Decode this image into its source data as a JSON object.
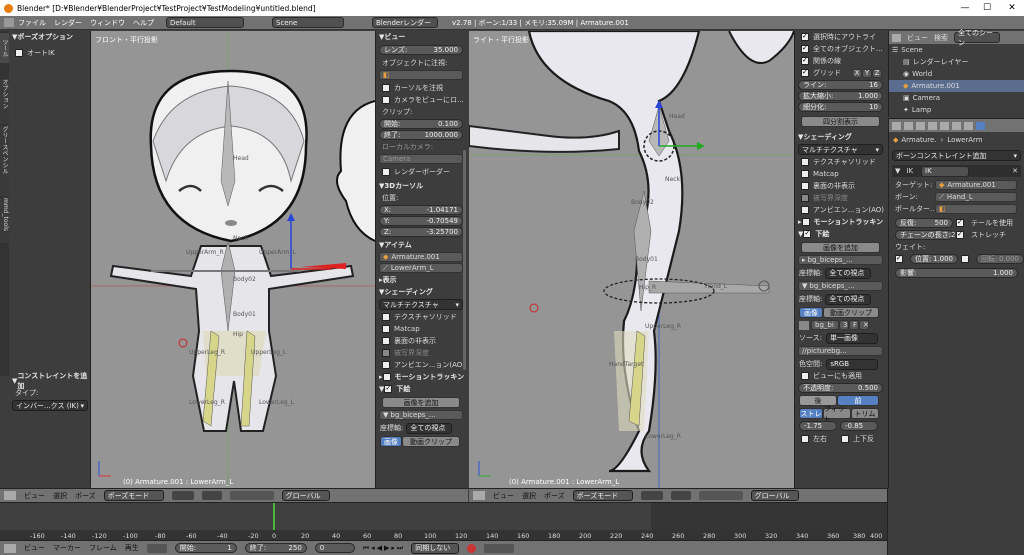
{
  "window": {
    "title": "Blender* [D:¥Blender¥BlenderProject¥TestProject¥TestModeling¥untitled.blend]",
    "min": "—",
    "max": "☐",
    "close": "✕"
  },
  "menubar": {
    "items": [
      "ファイル",
      "レンダー",
      "ウィンドウ",
      "ヘルプ"
    ],
    "layout": "Default",
    "scene": "Scene",
    "engine": "Blenderレンダー",
    "info": "v2.78 | ボーン:1/33 | メモリ:35.09M | Armature.001"
  },
  "left_tabs": [
    "ツール",
    "オプション",
    "グリースペンシル",
    "mmd_tools"
  ],
  "pose_options": {
    "header": "ポーズオプション",
    "auto_ik": "オートIK"
  },
  "constraint_add": {
    "header": "コンストレイントを追加",
    "type_label": "タイプ:",
    "type_value": "インバー...クス (IK)"
  },
  "viewport_left": {
    "title": "フロント・平行投影",
    "status": "(0) Armature.001 : LowerArm_L"
  },
  "viewport_right": {
    "title": "ライト・平行投影",
    "status": "(0) Armature.001 : LowerArm_L"
  },
  "bone_labels_left": [
    "Head",
    "Neck",
    "UpperArm_R",
    "UpperArm_L",
    "Body02",
    "Body01",
    "Hip",
    "UpperLeg_R",
    "UpperLeg_L",
    "LowerLeg_R",
    "LowerLeg_L"
  ],
  "bone_labels_right": [
    "Head",
    "Neck",
    "Body02",
    "Body01",
    "Hip_R",
    "UpperLeg_R",
    "LowerLeg_R",
    "HandTarget",
    "Hand_L"
  ],
  "nprops": {
    "view_header": "ビュー",
    "lens_label": "レンズ:",
    "lens_value": "35.000",
    "lock_obj_label": "オブジェクトに注視:",
    "lock_cursor": "カーソルを注視",
    "lock_camera": "カメラをビューにロ...",
    "clip_label": "クリップ:",
    "clip_start_label": "開始:",
    "clip_start": "0.100",
    "clip_end_label": "終了:",
    "clip_end": "1000.000",
    "local_camera": "ローカルカメラ:",
    "camera": "Camera",
    "render_border": "レンダーボーダー",
    "cursor_header": "3Dカーソル",
    "location": "位置:",
    "x_label": "X:",
    "x": "-1.04171",
    "y_label": "Y:",
    "y": "-0.70549",
    "z_label": "Z:",
    "z": "-3.25700",
    "item_header": "アイテム",
    "item_name": "Armature.001",
    "bone_name": "LowerArm_L",
    "display_header": "表示",
    "shading_header": "シェーディング",
    "shading_mode": "マルチテクスチャ",
    "tex_solid": "テクスチャソリッド",
    "matcap": "Matcap",
    "backface": "裏面の非表示",
    "depth_of_field": "被写界深度",
    "ao": "アンビエン...ョン(AO)",
    "motion_track": "モーショントラッキン",
    "background": "下絵",
    "add_image": "画像を追加",
    "bg_name": "bg_biceps_...",
    "axis_label": "座標軸:",
    "axis_value": "全ての視点",
    "image_btn": "画像",
    "movie_btn": "動画クリップ"
  },
  "nprops_right": {
    "items": [
      "選択時にアウトライ",
      "全てのオブジェクト...",
      "関係の線"
    ],
    "grid_label": "グリッド",
    "grid_x": "X",
    "grid_y": "Y",
    "grid_z": "Z",
    "lines_label": "ライン:",
    "lines": "16",
    "scale_label": "拡大縮小:",
    "scale": "1.000",
    "subdiv_label": "細分化:",
    "subdiv": "10",
    "quad_view": "四分割表示",
    "shading_header": "シェーディング",
    "shading_mode": "マルチテクスチャ",
    "tex_solid": "テクスチャソリッド",
    "matcap": "Matcap",
    "backface": "裏面の非表示",
    "dof": "被写界深度",
    "ao": "アンビエン...ョン(AO)",
    "motion_track": "モーショントラッキン",
    "background": "下絵",
    "add_image": "画像を追加",
    "bg1": "bg_biceps_...",
    "axis_label": "座標軸:",
    "axis_value": "全ての視点",
    "bg2": "bg_biceps_...",
    "image_btn": "画像",
    "movie_btn": "動画クリップ",
    "img_name": "bg_bi",
    "img_num": "3",
    "source_label": "ソース:",
    "source": "単一画像",
    "path": "//picturebg...",
    "colorspace_label": "色空間:",
    "colorspace": "sRGB",
    "front_check": "ビューにも適用",
    "opacity_label": "不透明度:",
    "opacity": "0.500",
    "back_btn": "後",
    "front_btn": "前",
    "stretch_btn": "ストレ",
    "fit_btn": "フィット",
    "crop_btn": "トリム",
    "x_off": "-1.75",
    "y_off": "-0.85",
    "flip_x": "左右",
    "flip_y": "上下反"
  },
  "outliner": {
    "tabs": [
      "ビュー",
      "検索",
      "全てのシーン"
    ],
    "items": [
      "Scene",
      "レンダーレイヤー",
      "World",
      "Armature.001",
      "Camera",
      "Lamp"
    ]
  },
  "properties": {
    "breadcrumb_a": "Armature.",
    "breadcrumb_b": "LowerArm",
    "add_constraint": "ボーンコンストレイント追加",
    "ik_label": "IK",
    "ik_name": "IK",
    "target_label": "ターゲット:",
    "target": "Armature.001",
    "bone_label": "ボーン:",
    "bone": "Hand_L",
    "pole_label": "ポールター...",
    "iter_label": "反復:",
    "iter": "500",
    "use_tail": "テールを使用",
    "chain_label": "チェーンの長さ:",
    "chain": "2",
    "stretch": "ストレッチ",
    "weight_header": "ウェイト:",
    "pos_label": "位置:",
    "pos": "1.000",
    "rot_label": "回転:",
    "rot": "0.000",
    "influence_label": "影響:",
    "influence": "1.000"
  },
  "toolbar_left": {
    "view": "ビュー",
    "select": "選択",
    "pose": "ポーズ",
    "mode": "ポーズモード",
    "global": "グローバル"
  },
  "toolbar_right": {
    "view": "ビュー",
    "select": "選択",
    "pose": "ポーズ",
    "mode": "ポーズモード",
    "global": "グローバル"
  },
  "timeline": {
    "ticks": [
      "-160",
      "-140",
      "-120",
      "-100",
      "-80",
      "-60",
      "-40",
      "-20",
      "0",
      "20",
      "40",
      "60",
      "80",
      "100",
      "120",
      "140",
      "160",
      "180",
      "200",
      "220",
      "240",
      "260",
      "280",
      "300",
      "320",
      "340",
      "360",
      "380",
      "400"
    ],
    "view": "ビュー",
    "marker": "マーカー",
    "frame": "フレーム",
    "playback": "再生",
    "start_label": "開始:",
    "start": "1",
    "end_label": "終了:",
    "end": "250",
    "current": "0",
    "sync": "同期しない"
  }
}
